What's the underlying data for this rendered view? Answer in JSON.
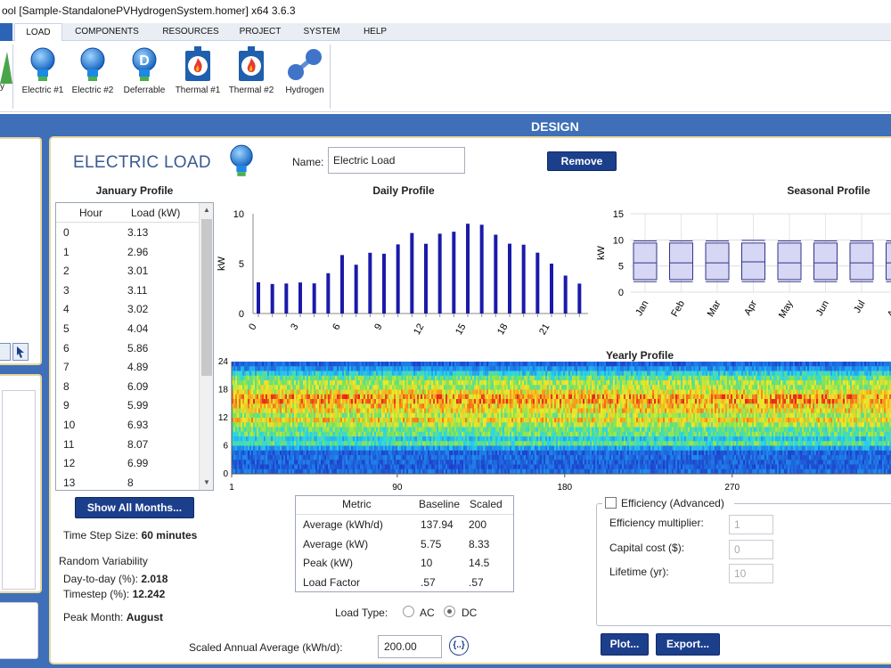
{
  "window": {
    "title": "ool [Sample-StandalonePVHydrogenSystem.homer]   x64 3.6.3"
  },
  "menu": {
    "items": [
      {
        "label": "LOAD",
        "active": true
      },
      {
        "label": "COMPONENTS"
      },
      {
        "label": "RESOURCES"
      },
      {
        "label": "PROJECT"
      },
      {
        "label": "SYSTEM"
      },
      {
        "label": "HELP"
      }
    ]
  },
  "ribbon": {
    "left_partial_label": "y",
    "buttons": [
      {
        "label": "Electric #1",
        "icon": "lightbulb-icon"
      },
      {
        "label": "Electric #2",
        "icon": "lightbulb-icon"
      },
      {
        "label": "Deferrable",
        "icon": "deferrable-bulb-icon"
      },
      {
        "label": "Thermal #1",
        "icon": "flame-icon"
      },
      {
        "label": "Thermal #2",
        "icon": "flame-icon"
      },
      {
        "label": "Hydrogen",
        "icon": "molecule-icon"
      }
    ]
  },
  "design_bar": {
    "title": "DESIGN"
  },
  "load": {
    "heading": "ELECTRIC LOAD",
    "name_label": "Name:",
    "name_value": "Electric Load",
    "remove_label": "Remove"
  },
  "january_profile": {
    "title": "January Profile",
    "col_hour": "Hour",
    "col_load": "Load (kW)",
    "rows": [
      {
        "hour": "0",
        "load": "3.13"
      },
      {
        "hour": "1",
        "load": "2.96"
      },
      {
        "hour": "2",
        "load": "3.01"
      },
      {
        "hour": "3",
        "load": "3.11"
      },
      {
        "hour": "4",
        "load": "3.02"
      },
      {
        "hour": "5",
        "load": "4.04"
      },
      {
        "hour": "6",
        "load": "5.86"
      },
      {
        "hour": "7",
        "load": "4.89"
      },
      {
        "hour": "8",
        "load": "6.09"
      },
      {
        "hour": "9",
        "load": "5.99"
      },
      {
        "hour": "10",
        "load": "6.93"
      },
      {
        "hour": "11",
        "load": "8.07"
      },
      {
        "hour": "12",
        "load": "6.99"
      },
      {
        "hour": "13",
        "load": "8"
      }
    ],
    "show_all_label": "Show All Months..."
  },
  "settings": {
    "time_step_label": "Time Step Size:",
    "time_step_value": "60 minutes",
    "random_variability_label": "Random Variability",
    "day_to_day_label": "Day-to-day (%):",
    "day_to_day_value": "2.018",
    "timestep_label": "Timestep (%):",
    "timestep_value": "12.242",
    "peak_month_label": "Peak Month:",
    "peak_month_value": "August"
  },
  "chart_data": [
    {
      "type": "bar",
      "title": "Daily Profile",
      "ylabel": "kW",
      "ylim": [
        0,
        10
      ],
      "yticks": [
        "0",
        "5",
        "10"
      ],
      "xticks": [
        "0",
        "3",
        "6",
        "9",
        "12",
        "15",
        "18",
        "21"
      ],
      "x": [
        0,
        1,
        2,
        3,
        4,
        5,
        6,
        7,
        8,
        9,
        10,
        11,
        12,
        13,
        14,
        15,
        16,
        17,
        18,
        19,
        20,
        21,
        22,
        23
      ],
      "values": [
        3.13,
        2.96,
        3.01,
        3.11,
        3.02,
        4.04,
        5.86,
        4.89,
        6.09,
        5.99,
        6.93,
        8.07,
        6.99,
        8.0,
        8.2,
        9.0,
        8.9,
        7.9,
        7.0,
        6.9,
        6.1,
        5.0,
        3.8,
        3.0
      ],
      "color": "#1a1aaa"
    },
    {
      "type": "box",
      "title": "Seasonal Profile",
      "ylabel": "kW",
      "ylim": [
        0,
        15
      ],
      "yticks": [
        "0",
        "5",
        "10",
        "15"
      ],
      "categories": [
        "Jan",
        "Feb",
        "Mar",
        "Apr",
        "May",
        "Jun",
        "Jul",
        "Aug"
      ],
      "boxes": [
        {
          "min": 2.0,
          "q1": 2.4,
          "median": 5.6,
          "q3": 9.4,
          "max": 9.8
        },
        {
          "min": 2.0,
          "q1": 2.4,
          "median": 5.6,
          "q3": 9.4,
          "max": 9.8
        },
        {
          "min": 2.0,
          "q1": 2.4,
          "median": 5.6,
          "q3": 9.4,
          "max": 9.8
        },
        {
          "min": 2.0,
          "q1": 2.4,
          "median": 5.8,
          "q3": 9.4,
          "max": 9.9
        },
        {
          "min": 2.0,
          "q1": 2.4,
          "median": 5.6,
          "q3": 9.4,
          "max": 9.8
        },
        {
          "min": 2.0,
          "q1": 2.4,
          "median": 5.6,
          "q3": 9.4,
          "max": 9.8
        },
        {
          "min": 2.0,
          "q1": 2.4,
          "median": 5.6,
          "q3": 9.4,
          "max": 9.8
        },
        {
          "min": 2.0,
          "q1": 2.4,
          "median": 5.6,
          "q3": 9.4,
          "max": 9.8
        }
      ],
      "fill": "#d6d6f5",
      "stroke": "#333388"
    },
    {
      "type": "heatmap",
      "title": "Yearly Profile",
      "yticks": [
        "0",
        "6",
        "12",
        "18",
        "24"
      ],
      "xticks": [
        "1",
        "90",
        "180",
        "270"
      ],
      "hourly_mean_kw": [
        3.13,
        2.96,
        3.01,
        3.11,
        3.02,
        4.04,
        5.86,
        4.89,
        6.09,
        5.99,
        6.93,
        8.07,
        6.99,
        8.0,
        8.2,
        9.0,
        8.9,
        7.9,
        7.0,
        6.9,
        6.1,
        5.0,
        3.8,
        3.0
      ],
      "colormap": [
        "#1e3cc8",
        "#1f8ff0",
        "#2bd6e6",
        "#7be35a",
        "#f0e92a",
        "#f79a1c",
        "#e8251a"
      ]
    }
  ],
  "metrics": {
    "col_metric": "Metric",
    "col_baseline": "Baseline",
    "col_scaled": "Scaled",
    "rows": [
      {
        "metric": "Average (kWh/d)",
        "baseline": "137.94",
        "scaled": "200"
      },
      {
        "metric": "Average (kW)",
        "baseline": "5.75",
        "scaled": "8.33"
      },
      {
        "metric": "Peak (kW)",
        "baseline": "10",
        "scaled": "14.5"
      },
      {
        "metric": "Load Factor",
        "baseline": ".57",
        "scaled": ".57"
      }
    ]
  },
  "load_type": {
    "label": "Load Type:",
    "ac": "AC",
    "dc": "DC",
    "selected": "DC"
  },
  "scaled_annual": {
    "label": "Scaled Annual Average (kWh/d):",
    "value": "200.00",
    "button": "{..}"
  },
  "efficiency": {
    "checkbox_label": "Efficiency (Advanced)",
    "multiplier_label": "Efficiency multiplier:",
    "multiplier_value": "1",
    "capital_label": "Capital cost ($):",
    "capital_value": "0",
    "lifetime_label": "Lifetime (yr):",
    "lifetime_value": "10"
  },
  "actions": {
    "plot": "Plot...",
    "export": "Export..."
  }
}
